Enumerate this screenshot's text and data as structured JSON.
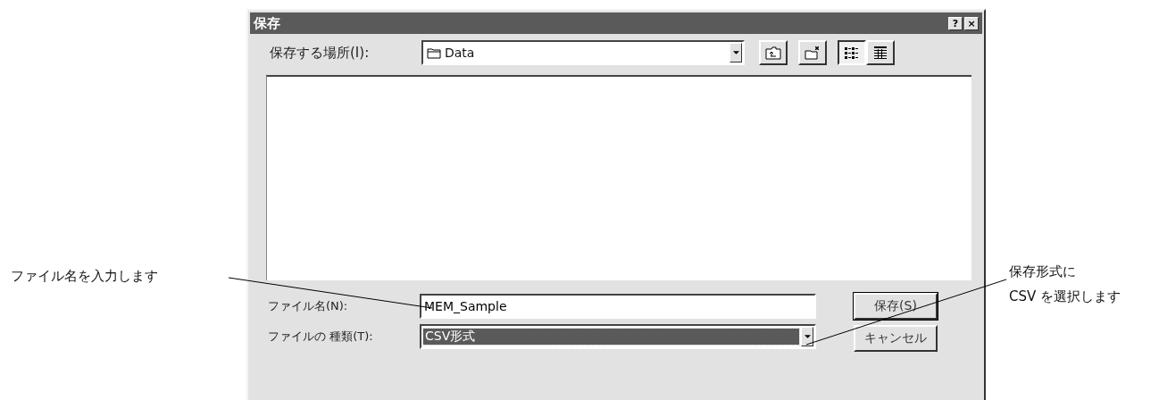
{
  "window": {
    "title": "保存",
    "title_buttons": [
      "?",
      "×"
    ]
  },
  "location": {
    "label": "保存する場所(I):",
    "value": "Data"
  },
  "toolbar": [
    {
      "kind": "up"
    },
    {
      "kind": "newfolder"
    },
    {
      "kind": "list",
      "selected": true
    },
    {
      "kind": "details",
      "selected": false
    }
  ],
  "file_name": {
    "label": "ファイル名(N):",
    "value": "MEM_Sample"
  },
  "file_type": {
    "label": "ファイルの 種類(T):",
    "value": "CSV形式",
    "focused": true
  },
  "buttons": [
    {
      "label": "保存(S)",
      "default": true
    },
    {
      "label": "キャンセル",
      "default": false
    }
  ],
  "callout_left": {
    "text": "ファイル名を入力します"
  },
  "callout_right": {
    "text": "保存形式に\nCSV を選択します"
  }
}
